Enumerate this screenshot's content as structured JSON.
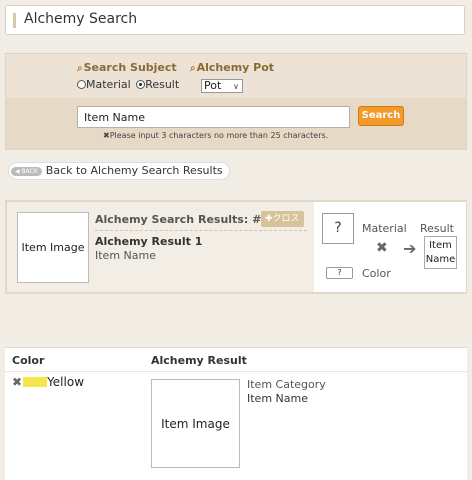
{
  "header": {
    "title": "Alchemy Search"
  },
  "search": {
    "subject_label": "Search Subject",
    "pot_label": "Alchemy Pot",
    "option_material": "Material",
    "option_result": "Result",
    "selected_option": "Result",
    "pot_value": "Pot",
    "input_value": "Item Name",
    "button_label": "Search",
    "hint": "Please input 3 characters no more than 25 characters."
  },
  "nav": {
    "back_badge": "BACK",
    "back_label": "Back to Alchemy Search Results"
  },
  "result_card": {
    "image_label": "Item Image",
    "heading": "Alchemy Search Results: #",
    "cross_tag": "クロス",
    "result_title": "Alchemy Result 1",
    "item_name": "Item Name",
    "material_label": "Material",
    "result_label": "Result",
    "color_label": "Color",
    "material_placeholder": "?",
    "color_placeholder": "?",
    "result_item": "Item Name"
  },
  "detail": {
    "col_color": "Color",
    "col_result": "Alchemy Result",
    "color_name": "Yellow",
    "color_hex": "#f7e64a",
    "image_label": "Item Image",
    "item_category": "Item Category",
    "item_name": "Item Name"
  },
  "colors": {
    "accent": "#f39a2a",
    "heading_brown": "#8a6b35"
  }
}
